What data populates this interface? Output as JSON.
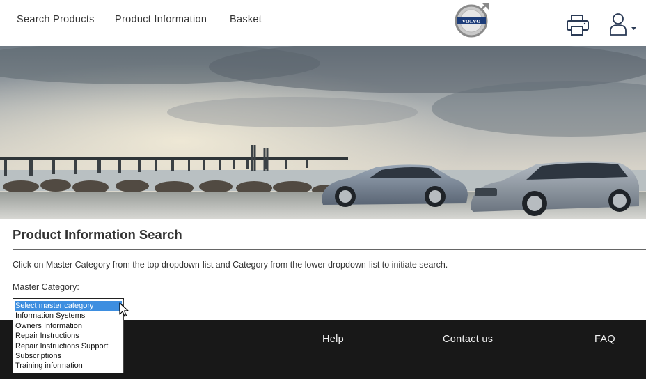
{
  "nav": {
    "search_products": "Search Products",
    "product_information": "Product Information",
    "basket": "Basket"
  },
  "logo": {
    "text": "VOLVO"
  },
  "icons": {
    "print": "printer-icon",
    "user": "user-icon",
    "caret": "caret-down-icon"
  },
  "main": {
    "title": "Product Information Search",
    "instructions": "Click on Master Category from the top dropdown-list and Category from the lower dropdown-list to initiate search.",
    "master_category_label": "Master Category:"
  },
  "dropdown": {
    "selected": "Select master category",
    "options": [
      "Select master category",
      "Information Systems",
      "Owners Information",
      "Repair Instructions",
      "Repair Instructions Support",
      "Subscriptions",
      "Training information"
    ]
  },
  "footer": {
    "help": "Help",
    "contact": "Contact us",
    "faq": "FAQ"
  },
  "colors": {
    "footer_bg": "#181818",
    "selection": "#3d8ee0",
    "logo_blue": "#1d3d7a"
  }
}
